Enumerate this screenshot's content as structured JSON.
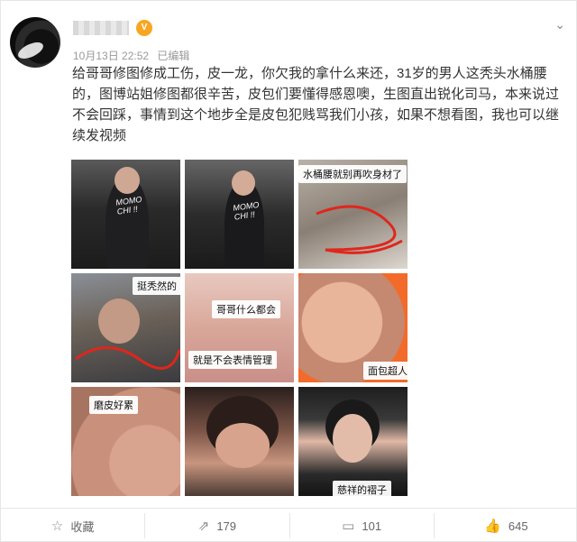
{
  "post": {
    "meta": {
      "time": "10月13日 22:52",
      "edited": "已编辑"
    },
    "text": "给哥哥修图修成工伤，皮一龙，你欠我的拿什么来还，31岁的男人这秃头水桶腰的，图博站姐修图都很辛苦，皮包们要懂得感恩噢，生图直出锐化司马，本来说过不会回踩，事情到这个地步全是皮包犯贱骂我们小孩，如果不想看图，我也可以继续发视频",
    "images": [
      {
        "caption": ""
      },
      {
        "caption": ""
      },
      {
        "caption": "水桶腰就别再吹身材了"
      },
      {
        "caption": "挺秃然的"
      },
      {
        "caption_top": "哥哥什么都会",
        "caption_bottom": "就是不会表情管理"
      },
      {
        "caption": "面包超人"
      },
      {
        "caption": "磨皮好累"
      },
      {
        "caption": ""
      },
      {
        "caption": "慈祥的褶子"
      }
    ]
  },
  "shirt_text": "MOMO CHI !!",
  "actions": {
    "favorite": {
      "icon": "star-icon",
      "label": "收藏"
    },
    "repost": {
      "icon": "share-icon",
      "count": "179"
    },
    "comment": {
      "icon": "comment-icon",
      "count": "101"
    },
    "like": {
      "icon": "thumb-up-icon",
      "count": "645"
    }
  }
}
